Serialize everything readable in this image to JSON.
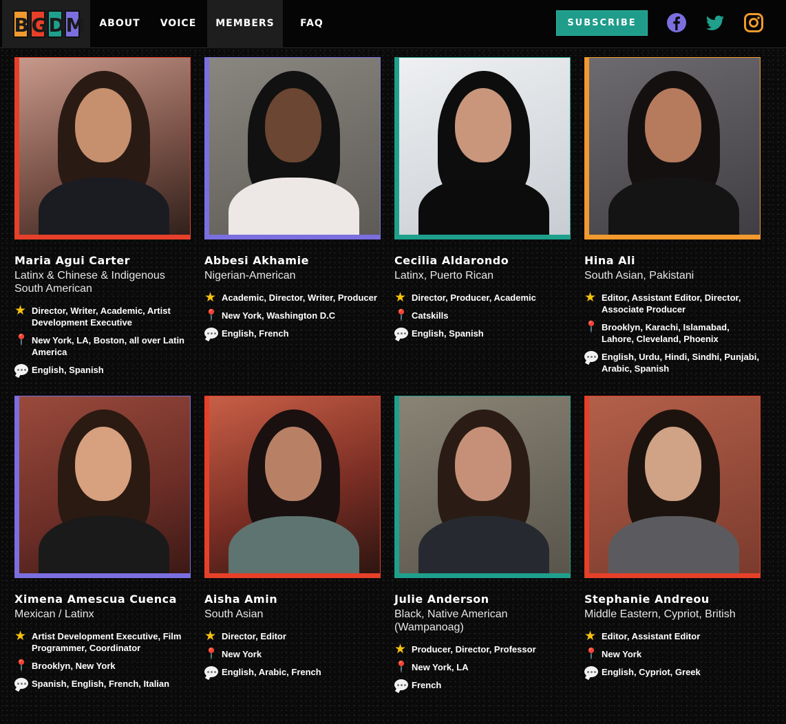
{
  "nav": {
    "logo_letters": [
      "B",
      "G",
      "D",
      "M"
    ],
    "logo_colors": [
      "#f29a2e",
      "#e7402a",
      "#1fa08d",
      "#7b6fe0"
    ],
    "items": [
      {
        "label": "ABOUT",
        "active": false
      },
      {
        "label": "VOICE",
        "active": false
      },
      {
        "label": "MEMBERS",
        "active": true
      },
      {
        "label": "FAQ",
        "active": false
      }
    ],
    "subscribe_label": "SUBSCRIBE",
    "social": [
      {
        "icon": "facebook-icon",
        "color": "#7b6fe0"
      },
      {
        "icon": "twitter-icon",
        "color": "#1fa08d"
      },
      {
        "icon": "instagram-icon",
        "color": "#f29a2e"
      }
    ]
  },
  "icons": {
    "role": "star-icon",
    "location": "pin-icon",
    "languages": "speech-bubble-icon"
  },
  "accent_colors": {
    "red": "#e7402a",
    "purple": "#7b6fe0",
    "teal": "#1fa08d",
    "orange": "#f29a2e"
  },
  "members": [
    {
      "name": "Maria Agui Carter",
      "identity": "Latinx & Chinese & Indigenous South American",
      "roles": "Director, Writer, Academic, Artist Development Executive",
      "location": "New York, LA, Boston, all over Latin America",
      "languages": "English, Spanish",
      "accent": "#e7402a"
    },
    {
      "name": "Abbesi Akhamie",
      "identity": "Nigerian-American",
      "roles": "Academic, Director, Writer, Producer",
      "location": "New York, Washington D.C",
      "languages": "English, French",
      "accent": "#7b6fe0"
    },
    {
      "name": "Cecilia Aldarondo",
      "identity": "Latinx, Puerto Rican",
      "roles": "Director, Producer, Academic",
      "location": "Catskills",
      "languages": "English, Spanish",
      "accent": "#1fa08d"
    },
    {
      "name": "Hina Ali",
      "identity": "South Asian, Pakistani",
      "roles": "Editor, Assistant Editor, Director, Associate Producer",
      "location": "Brooklyn, Karachi, Islamabad, Lahore, Cleveland, Phoenix",
      "languages": "English, Urdu, Hindi, Sindhi, Punjabi, Arabic, Spanish",
      "accent": "#f29a2e"
    },
    {
      "name": "Ximena Amescua Cuenca",
      "identity": "Mexican / Latinx",
      "roles": "Artist Development Executive, Film Programmer, Coordinator",
      "location": "Brooklyn, New York",
      "languages": "Spanish, English, French, Italian",
      "accent": "#7b6fe0"
    },
    {
      "name": "Aisha Amin",
      "identity": "South Asian",
      "roles": "Director, Editor",
      "location": "New York",
      "languages": "English, Arabic, French",
      "accent": "#e7402a"
    },
    {
      "name": "Julie Anderson",
      "identity": "Black, Native American (Wampanoag)",
      "roles": "Producer, Director, Professor",
      "location": "New York, LA",
      "languages": "French",
      "accent": "#1fa08d"
    },
    {
      "name": "Stephanie Andreou",
      "identity": "Middle Eastern, Cypriot, British",
      "roles": "Editor, Assistant Editor",
      "location": "New York",
      "languages": "English, Cypriot, Greek",
      "accent": "#e7402a"
    }
  ]
}
